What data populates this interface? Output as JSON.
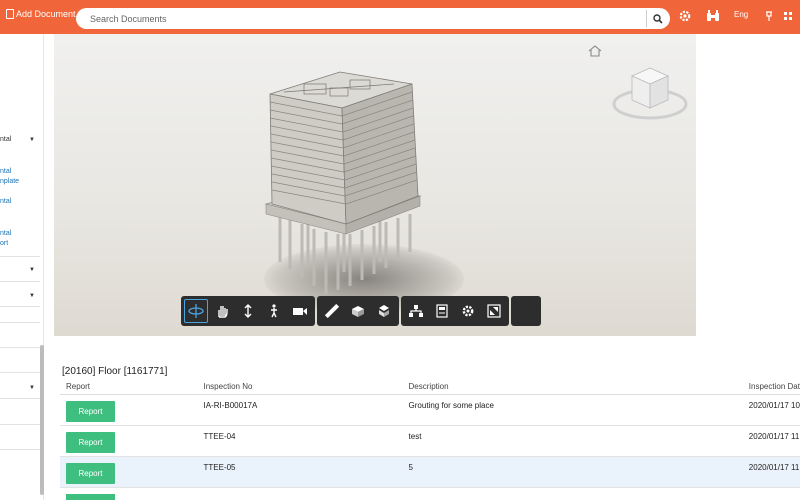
{
  "header": {
    "add_document_label": "Add Document",
    "search_placeholder": "Search Documents",
    "language": "Eng",
    "icons": [
      "search-icon",
      "gear-icon",
      "binoculars-icon",
      "pin-icon",
      "grid-icon"
    ],
    "accent_color": "#f0663a"
  },
  "sidebar": {
    "section_label": "ntal",
    "links": [
      "ntal",
      "nplate",
      "ntal",
      "ntal",
      "ort"
    ]
  },
  "viewer": {
    "toolbar_groups": [
      [
        "orbit-icon",
        "pan-icon",
        "zoom-icon",
        "walk-icon",
        "camera-icon"
      ],
      [
        "measure-icon",
        "section-icon",
        "explode-icon"
      ],
      [
        "model-browser-icon",
        "properties-icon",
        "settings-icon",
        "fullscreen-icon"
      ],
      [
        "blank-icon"
      ]
    ]
  },
  "inspection": {
    "title": "[20160] Floor [1161771]",
    "columns": [
      "Report",
      "Inspection No",
      "Description",
      "Inspection Dat"
    ],
    "rows": [
      {
        "button": "Report",
        "no": "IA-RI-B00017A",
        "description": "Grouting for some place",
        "date": "2020/01/17 10"
      },
      {
        "button": "Report",
        "no": "TTEE-04",
        "description": "test",
        "date": "2020/01/17 11"
      },
      {
        "button": "Report",
        "no": "TTEE-05",
        "description": "5",
        "date": "2020/01/17 11"
      }
    ],
    "button_color": "#3fbf7f"
  }
}
